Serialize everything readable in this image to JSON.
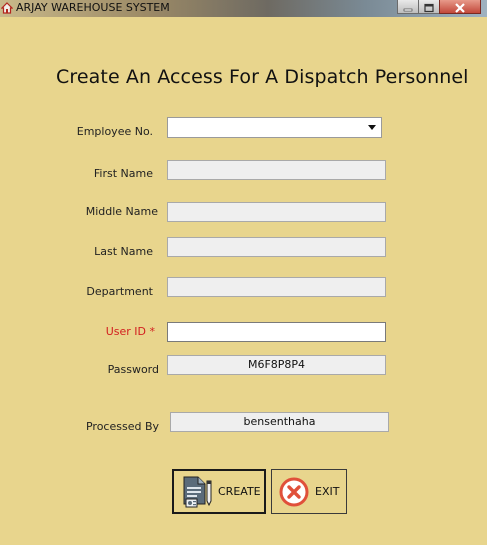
{
  "window": {
    "title": "ARJAY WAREHOUSE SYSTEM"
  },
  "form": {
    "heading": "Create An Access For A Dispatch Personnel",
    "employee_no": {
      "label": "Employee No.",
      "value": ""
    },
    "first_name": {
      "label": "First Name",
      "value": ""
    },
    "middle_name": {
      "label": "Middle Name",
      "value": ""
    },
    "last_name": {
      "label": "Last Name",
      "value": ""
    },
    "department": {
      "label": "Department",
      "value": ""
    },
    "user_id": {
      "label": "User ID *",
      "value": ""
    },
    "password": {
      "label": "Password",
      "value": "M6F8P8P4"
    },
    "processed_by": {
      "label": "Processed By",
      "value": "bensenthaha"
    }
  },
  "buttons": {
    "create": "CREATE",
    "exit": "EXIT"
  },
  "colors": {
    "background": "#e8d58d",
    "required_label": "#d21f1f",
    "exit_icon": "#e0503a"
  }
}
